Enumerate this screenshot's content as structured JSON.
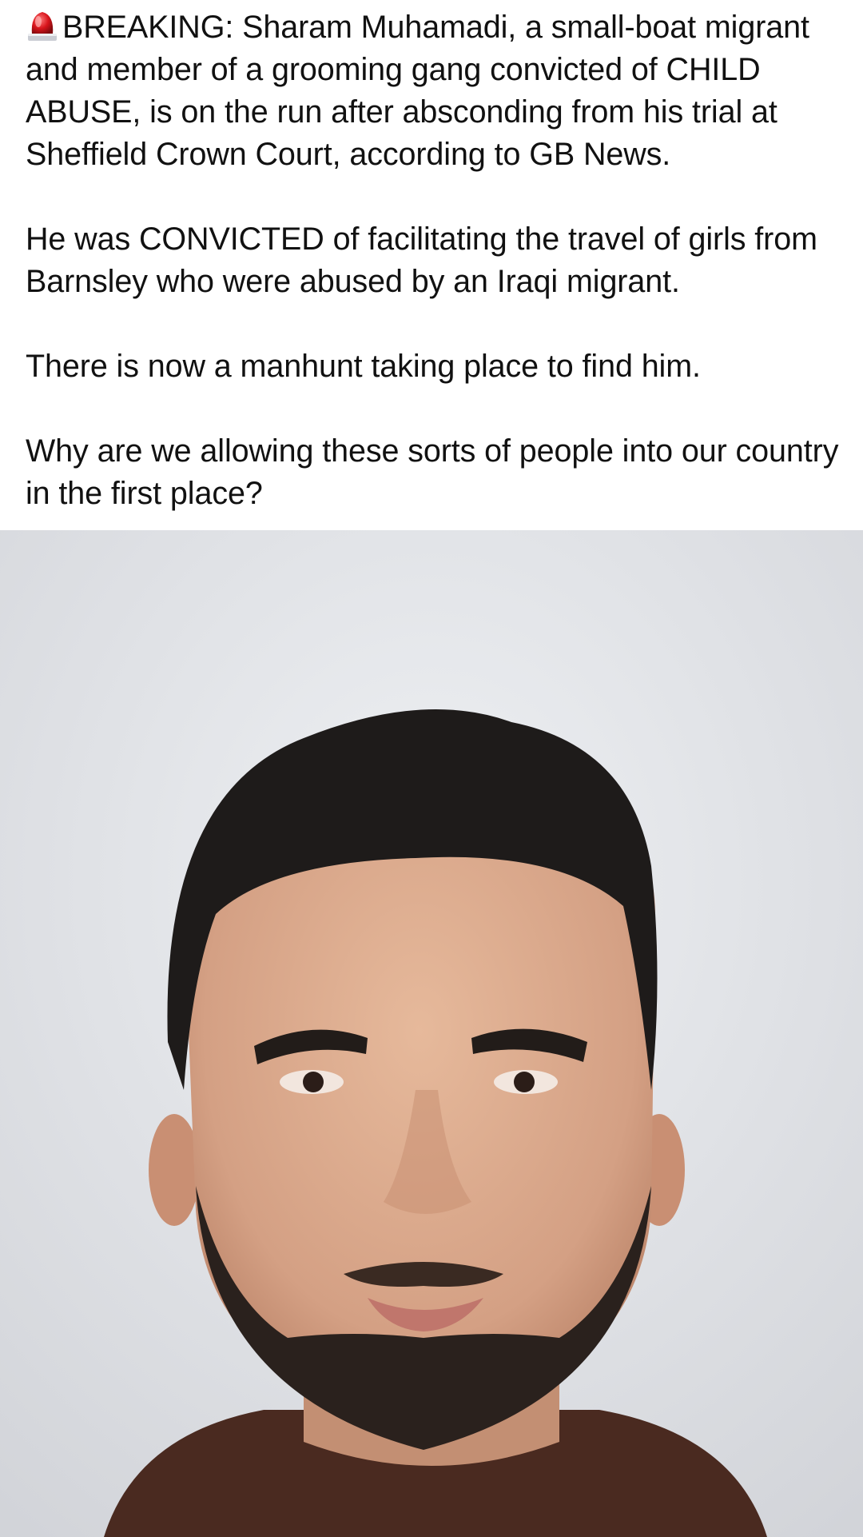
{
  "post": {
    "paragraph_1": "BREAKING: Sharam Muhamadi, a small-boat migrant and member of a grooming gang convicted of CHILD ABUSE, is on the run after absconding from his trial at Sheffield Crown Court, according to GB News.",
    "paragraph_2": "He was CONVICTED of facilitating the travel of girls from Barnsley who were abused by an Iraqi migrant.",
    "paragraph_3": "There is now a manhunt taking place to find him.",
    "paragraph_4": "Why are we allowing these sorts of people into our country in the first place?",
    "leading_icon": "police-siren-emoji"
  },
  "photo": {
    "icon": "mugshot-photo",
    "background_color": "#e4e5e9",
    "shirt_color": "#4a2a20",
    "hair_color": "#1e1b1a",
    "skin_color": "#d9a88a"
  }
}
